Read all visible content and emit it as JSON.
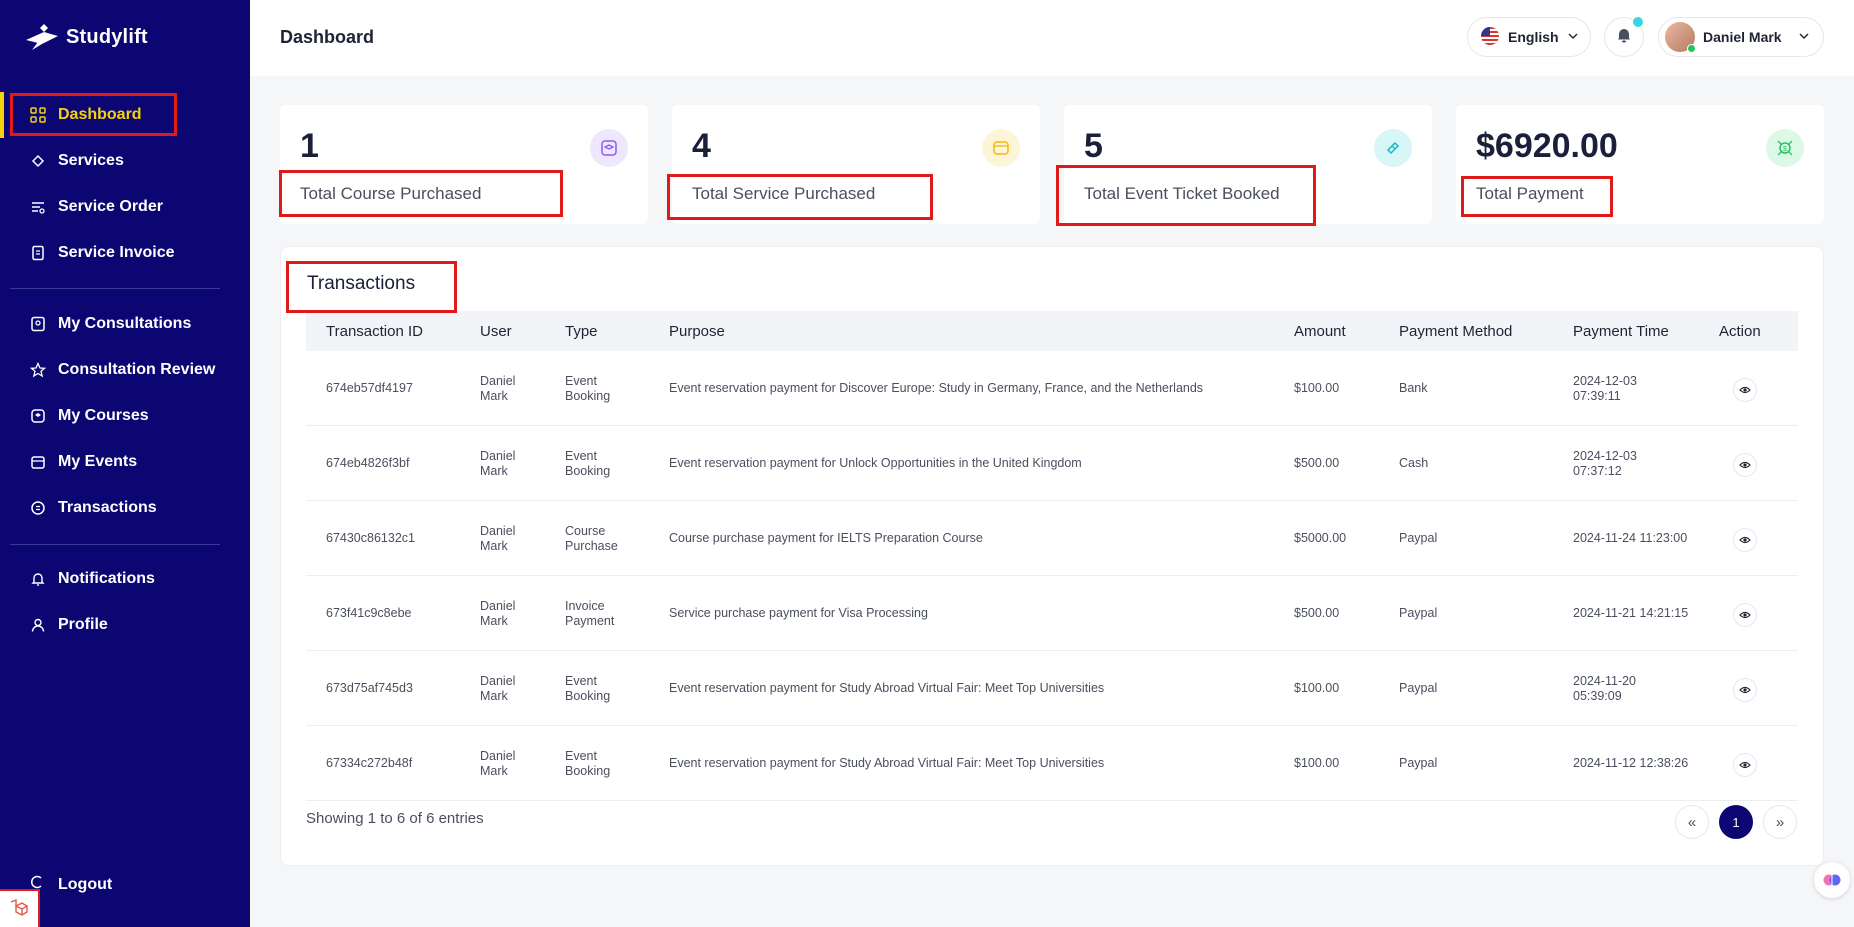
{
  "brand": {
    "name": "Studylift"
  },
  "sidebar": {
    "items": [
      {
        "label": "Dashboard",
        "icon": "dashboard-icon",
        "active": true
      },
      {
        "label": "Services",
        "icon": "services-icon"
      },
      {
        "label": "Service Order",
        "icon": "service-order-icon"
      },
      {
        "label": "Service Invoice",
        "icon": "invoice-icon"
      },
      {
        "label": "My Consultations",
        "icon": "consultation-icon"
      },
      {
        "label": "Consultation Review",
        "icon": "star-icon"
      },
      {
        "label": "My Courses",
        "icon": "courses-icon"
      },
      {
        "label": "My Events",
        "icon": "calendar-icon"
      },
      {
        "label": "Transactions",
        "icon": "transactions-icon"
      },
      {
        "label": "Notifications",
        "icon": "bell-icon"
      },
      {
        "label": "Profile",
        "icon": "user-icon"
      }
    ],
    "logout_label": "Logout"
  },
  "header": {
    "title": "Dashboard",
    "language": "English",
    "user_name": "Daniel Mark"
  },
  "stats": [
    {
      "value": "1",
      "label": "Total Course Purchased",
      "icon": "graduation-cap-icon",
      "color": "#8b5cf6"
    },
    {
      "value": "4",
      "label": "Total Service Purchased",
      "icon": "package-icon",
      "color": "#f5b70b"
    },
    {
      "value": "5",
      "label": "Total Event Ticket Booked",
      "icon": "ticket-icon",
      "color": "#14b8c4"
    },
    {
      "value": "$6920.00",
      "label": "Total Payment",
      "icon": "money-icon",
      "color": "#22c55e"
    }
  ],
  "transactions": {
    "title": "Transactions",
    "columns": [
      "Transaction ID",
      "User",
      "Type",
      "Purpose",
      "Amount",
      "Payment Method",
      "Payment Time",
      "Action"
    ],
    "rows": [
      {
        "id": "674eb57df4197",
        "user": [
          "Daniel",
          "Mark"
        ],
        "type": [
          "Event",
          "Booking"
        ],
        "purpose": "Event reservation payment for Discover Europe: Study in Germany, France, and the Netherlands",
        "amount": "$100.00",
        "method": "Bank",
        "time": [
          "2024-12-03",
          "07:39:11"
        ]
      },
      {
        "id": "674eb4826f3bf",
        "user": [
          "Daniel",
          "Mark"
        ],
        "type": [
          "Event",
          "Booking"
        ],
        "purpose": "Event reservation payment for Unlock Opportunities in the United Kingdom",
        "amount": "$500.00",
        "method": "Cash",
        "time": [
          "2024-12-03",
          "07:37:12"
        ]
      },
      {
        "id": "67430c86132c1",
        "user": [
          "Daniel",
          "Mark"
        ],
        "type": [
          "Course",
          "Purchase"
        ],
        "purpose": "Course purchase payment for IELTS Preparation Course",
        "amount": "$5000.00",
        "method": "Paypal",
        "time": [
          "2024-11-24 11:23:00"
        ]
      },
      {
        "id": "673f41c9c8ebe",
        "user": [
          "Daniel",
          "Mark"
        ],
        "type": [
          "Invoice",
          "Payment"
        ],
        "purpose": "Service purchase payment for Visa Processing",
        "amount": "$500.00",
        "method": "Paypal",
        "time": [
          "2024-11-21 14:21:15"
        ]
      },
      {
        "id": "673d75af745d3",
        "user": [
          "Daniel",
          "Mark"
        ],
        "type": [
          "Event",
          "Booking"
        ],
        "purpose": "Event reservation payment for Study Abroad Virtual Fair: Meet Top Universities",
        "amount": "$100.00",
        "method": "Paypal",
        "time": [
          "2024-11-20",
          "05:39:09"
        ]
      },
      {
        "id": "67334c272b48f",
        "user": [
          "Daniel",
          "Mark"
        ],
        "type": [
          "Event",
          "Booking"
        ],
        "purpose": "Event reservation payment for Study Abroad Virtual Fair: Meet Top Universities",
        "amount": "$100.00",
        "method": "Paypal",
        "time": [
          "2024-11-12 12:38:26"
        ]
      }
    ],
    "footer_text": "Showing 1 to 6 of 6 entries",
    "pagination": {
      "prev": "«",
      "current": "1",
      "next": "»"
    }
  },
  "colors": {
    "sidebar_bg": "#0b0672",
    "active": "#f5d20c",
    "highlight": "#e01919"
  }
}
